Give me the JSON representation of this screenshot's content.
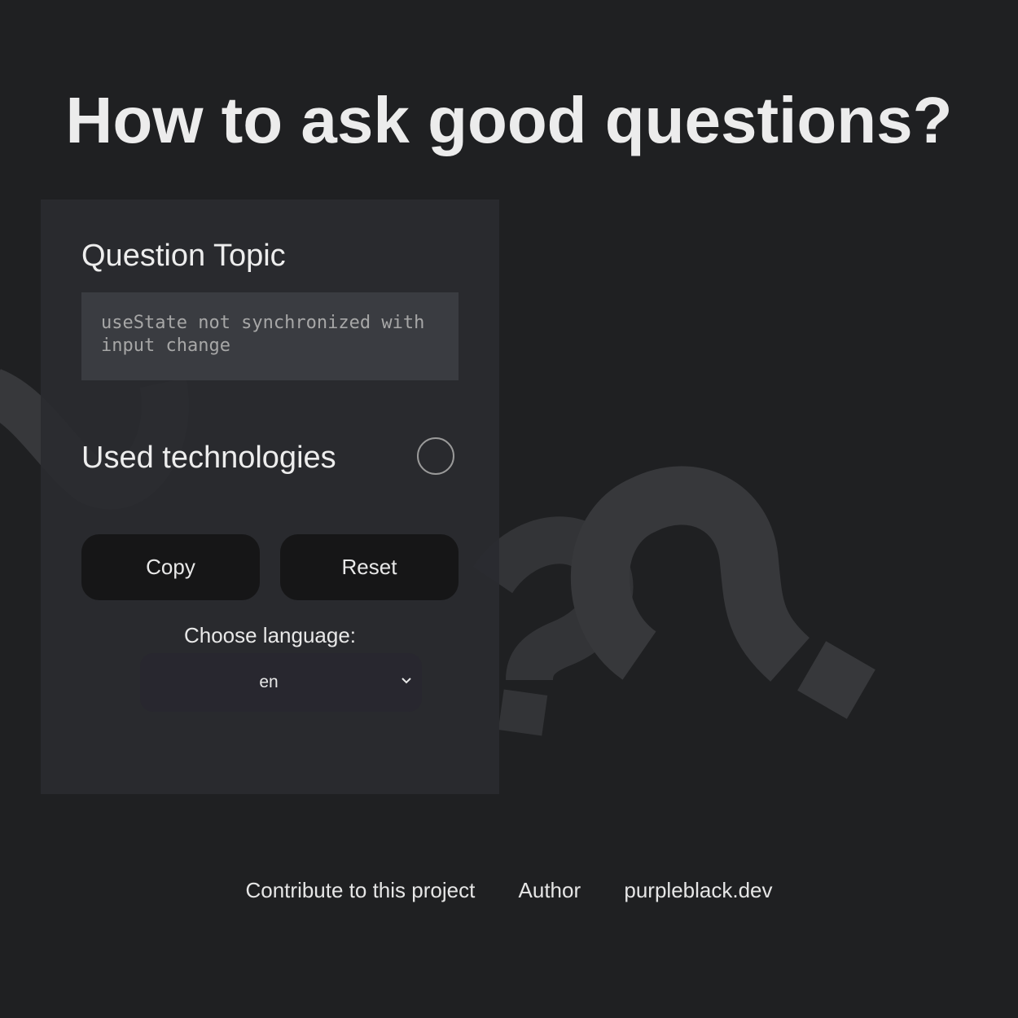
{
  "header": {
    "title": "How to ask good questions?"
  },
  "form": {
    "topic_heading": "Question Topic",
    "topic_value": "useState not synchronized with input change",
    "technologies_heading": "Used technologies",
    "technologies_toggle_icon": "circle-toggle-icon",
    "copy_label": "Copy",
    "reset_label": "Reset",
    "language_label": "Choose language:",
    "language_selected": "en",
    "language_chevron_icon": "chevron-down-icon"
  },
  "footer": {
    "links": [
      {
        "label": "Contribute to this project"
      },
      {
        "label": "Author"
      },
      {
        "label": "purpleblack.dev"
      }
    ]
  },
  "colors": {
    "background": "#1f2022",
    "card": "#2a2b2f",
    "input_background": "#3a3c41",
    "button_background": "#161617",
    "select_background": "#28272f",
    "text": "#e6e6e6",
    "decorative_shapes": "#3a3b3e"
  }
}
